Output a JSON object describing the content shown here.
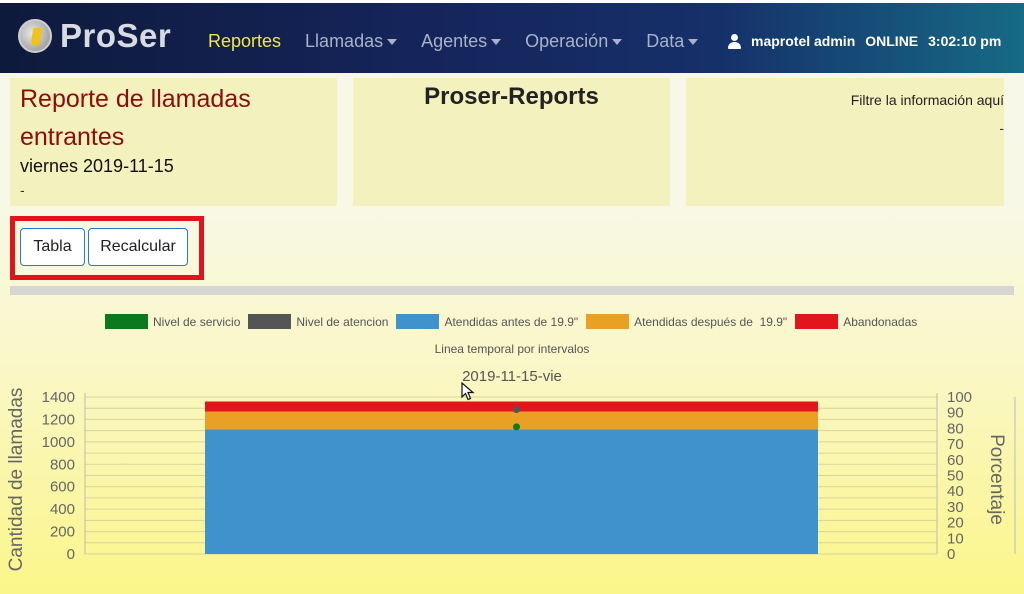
{
  "navbar": {
    "brand": "ProSer",
    "items": [
      {
        "label": "Reportes",
        "active": true,
        "dropdown": false
      },
      {
        "label": "Llamadas",
        "active": false,
        "dropdown": true
      },
      {
        "label": "Agentes",
        "active": false,
        "dropdown": true
      },
      {
        "label": "Operación",
        "active": false,
        "dropdown": true
      },
      {
        "label": "Data",
        "active": false,
        "dropdown": true
      }
    ],
    "user": "maprotel admin",
    "status": "ONLINE",
    "time": "3:02:10 pm"
  },
  "report": {
    "title": "Reporte de llamadas entrantes",
    "date": "viernes 2019-11-15",
    "note": "-"
  },
  "center_panel": {
    "title": "Proser-Reports"
  },
  "filter_panel": {
    "label": "Filtre la información aquí",
    "value": "-"
  },
  "buttons": {
    "tabla": "Tabla",
    "recalcular": "Recalcular"
  },
  "chart_data": {
    "type": "bar",
    "stacked": true,
    "subtitle": "Linea temporal por intervalos",
    "xlabel": "2019-11-15-vie",
    "ylabel": "Cantidad de llamadas",
    "y2label": "Porcentaje",
    "ylim": [
      0,
      1400
    ],
    "y2lim": [
      0,
      100
    ],
    "yticks": [
      0,
      200,
      400,
      600,
      800,
      1000,
      1200,
      1400
    ],
    "y2ticks": [
      0,
      10,
      20,
      30,
      40,
      50,
      60,
      70,
      80,
      90,
      100
    ],
    "grid": true,
    "legend_position": "top",
    "categories": [
      "2019-11-15-vie"
    ],
    "series": [
      {
        "name": "Nivel de servicio",
        "type": "point",
        "axis": "right",
        "color": "#0b7a1e",
        "values": [
          81
        ]
      },
      {
        "name": "Nivel de atencion",
        "type": "point",
        "axis": "right",
        "color": "#555555",
        "values": [
          92
        ]
      },
      {
        "name": "Atendidas antes de 19.9\"",
        "type": "bar",
        "axis": "left",
        "color": "#3f92cc",
        "values": [
          1110
        ]
      },
      {
        "name": "Atendidas después de  19.9\"",
        "type": "bar",
        "axis": "left",
        "color": "#e9a025",
        "values": [
          160
        ]
      },
      {
        "name": "Abandonadas",
        "type": "bar",
        "axis": "left",
        "color": "#e3141c",
        "values": [
          90
        ]
      }
    ]
  }
}
